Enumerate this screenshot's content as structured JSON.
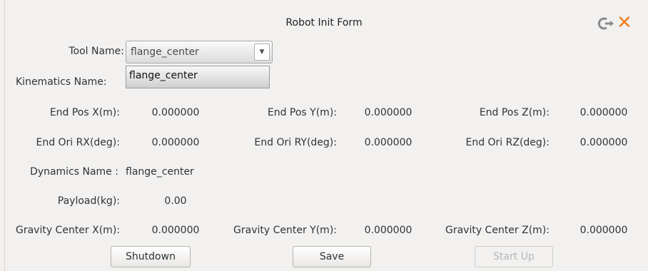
{
  "window": {
    "title": "Robot Init Form"
  },
  "tool": {
    "label": "Tool Name:",
    "value": "flange_center",
    "options": [
      "flange_center"
    ]
  },
  "kinematics": {
    "label": "Kinematics Name:"
  },
  "end_pos": {
    "x_label": "End Pos X(m):",
    "x_value": "0.000000",
    "y_label": "End Pos Y(m):",
    "y_value": "0.000000",
    "z_label": "End Pos Z(m):",
    "z_value": "0.000000"
  },
  "end_ori": {
    "rx_label": "End Ori RX(deg):",
    "rx_value": "0.000000",
    "ry_label": "End Ori RY(deg):",
    "ry_value": "0.000000",
    "rz_label": "End Ori RZ(deg):",
    "rz_value": "0.000000"
  },
  "dynamics": {
    "label": "Dynamics Name :",
    "value": "flange_center"
  },
  "payload": {
    "label": "Payload(kg):",
    "value": "0.00"
  },
  "gravity": {
    "x_label": "Gravity Center X(m):",
    "x_value": "0.000000",
    "y_label": "Gravity Center Y(m):",
    "y_value": "0.000000",
    "z_label": "Gravity Center Z(m):",
    "z_value": "0.000000"
  },
  "buttons": {
    "shutdown": "Shutdown",
    "save": "Save",
    "startup": "Start Up"
  },
  "icons": {
    "refresh": "refresh-icon",
    "close": "close-icon"
  },
  "colors": {
    "accent": "#f08024",
    "icon_gray": "#8a8a8a"
  }
}
